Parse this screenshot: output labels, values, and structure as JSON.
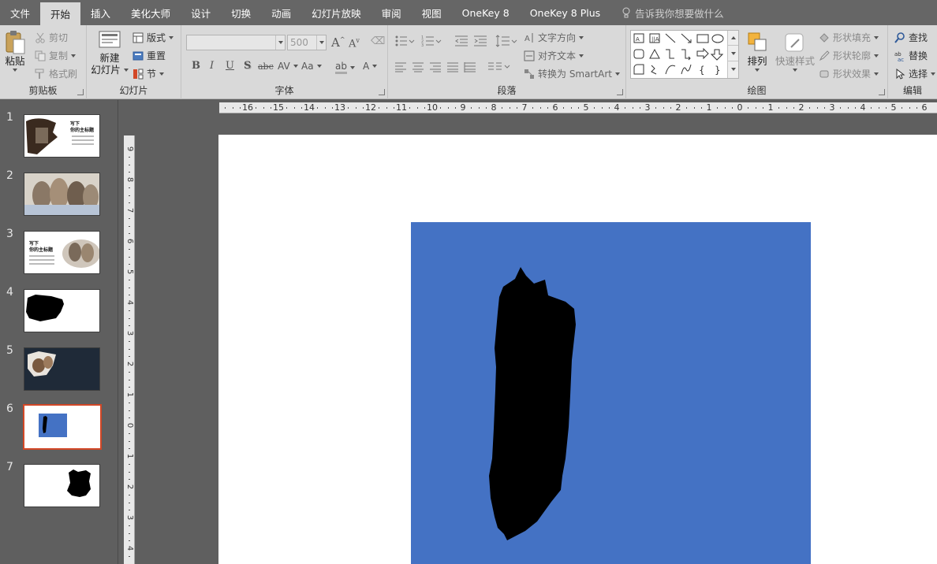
{
  "menu": {
    "tabs": [
      "文件",
      "开始",
      "插入",
      "美化大师",
      "设计",
      "切换",
      "动画",
      "幻灯片放映",
      "审阅",
      "视图",
      "OneKey 8",
      "OneKey 8 Plus"
    ],
    "active": "开始",
    "tell_me": "告诉我你想要做什么"
  },
  "clipboard": {
    "paste": "粘贴",
    "cut": "剪切",
    "copy": "复制",
    "format_painter": "格式刷",
    "label": "剪贴板"
  },
  "slides_group": {
    "new_slide_line1": "新建",
    "new_slide_line2": "幻灯片",
    "layout": "版式",
    "reset": "重置",
    "section": "节",
    "label": "幻灯片"
  },
  "font_group": {
    "font_size": "500",
    "label": "字体",
    "bold": "B",
    "italic": "I",
    "underline": "U",
    "shadow": "S",
    "strike": "abc",
    "spacing": "AV",
    "case": "Aa",
    "grow": "A",
    "shrink": "A",
    "highlight": "ab",
    "color": "A"
  },
  "paragraph_group": {
    "text_direction": "文字方向",
    "align_text": "对齐文本",
    "smartart": "转换为 SmartArt",
    "label": "段落"
  },
  "drawing_group": {
    "arrange": "排列",
    "quick_styles": "快速样式",
    "shape_fill": "形状填充",
    "shape_outline": "形状轮廓",
    "shape_effects": "形状效果",
    "label": "绘图"
  },
  "editing_group": {
    "find": "查找",
    "replace": "替换",
    "select": "选择",
    "label": "编辑"
  },
  "slides": [
    {
      "num": "1",
      "title": "写下",
      "subtitle": "你的主标题"
    },
    {
      "num": "2"
    },
    {
      "num": "3",
      "title": "写下",
      "subtitle": "你的主标题"
    },
    {
      "num": "4"
    },
    {
      "num": "5"
    },
    {
      "num": "6"
    },
    {
      "num": "7"
    }
  ],
  "selected_slide": "6",
  "h_ruler": [
    "16",
    "15",
    "14",
    "13",
    "12",
    "11",
    "10",
    "9",
    "8",
    "7",
    "6",
    "5",
    "4",
    "3",
    "2",
    "1",
    "0",
    "1",
    "2",
    "3",
    "4",
    "5",
    "6"
  ],
  "v_ruler": [
    "9",
    "8",
    "7",
    "6",
    "5",
    "4",
    "3",
    "2",
    "1",
    "0",
    "1",
    "2",
    "3",
    "4"
  ],
  "colors": {
    "slide_blue": "#4472c4",
    "selected_border": "#d24726",
    "brush_black": "#000000"
  }
}
